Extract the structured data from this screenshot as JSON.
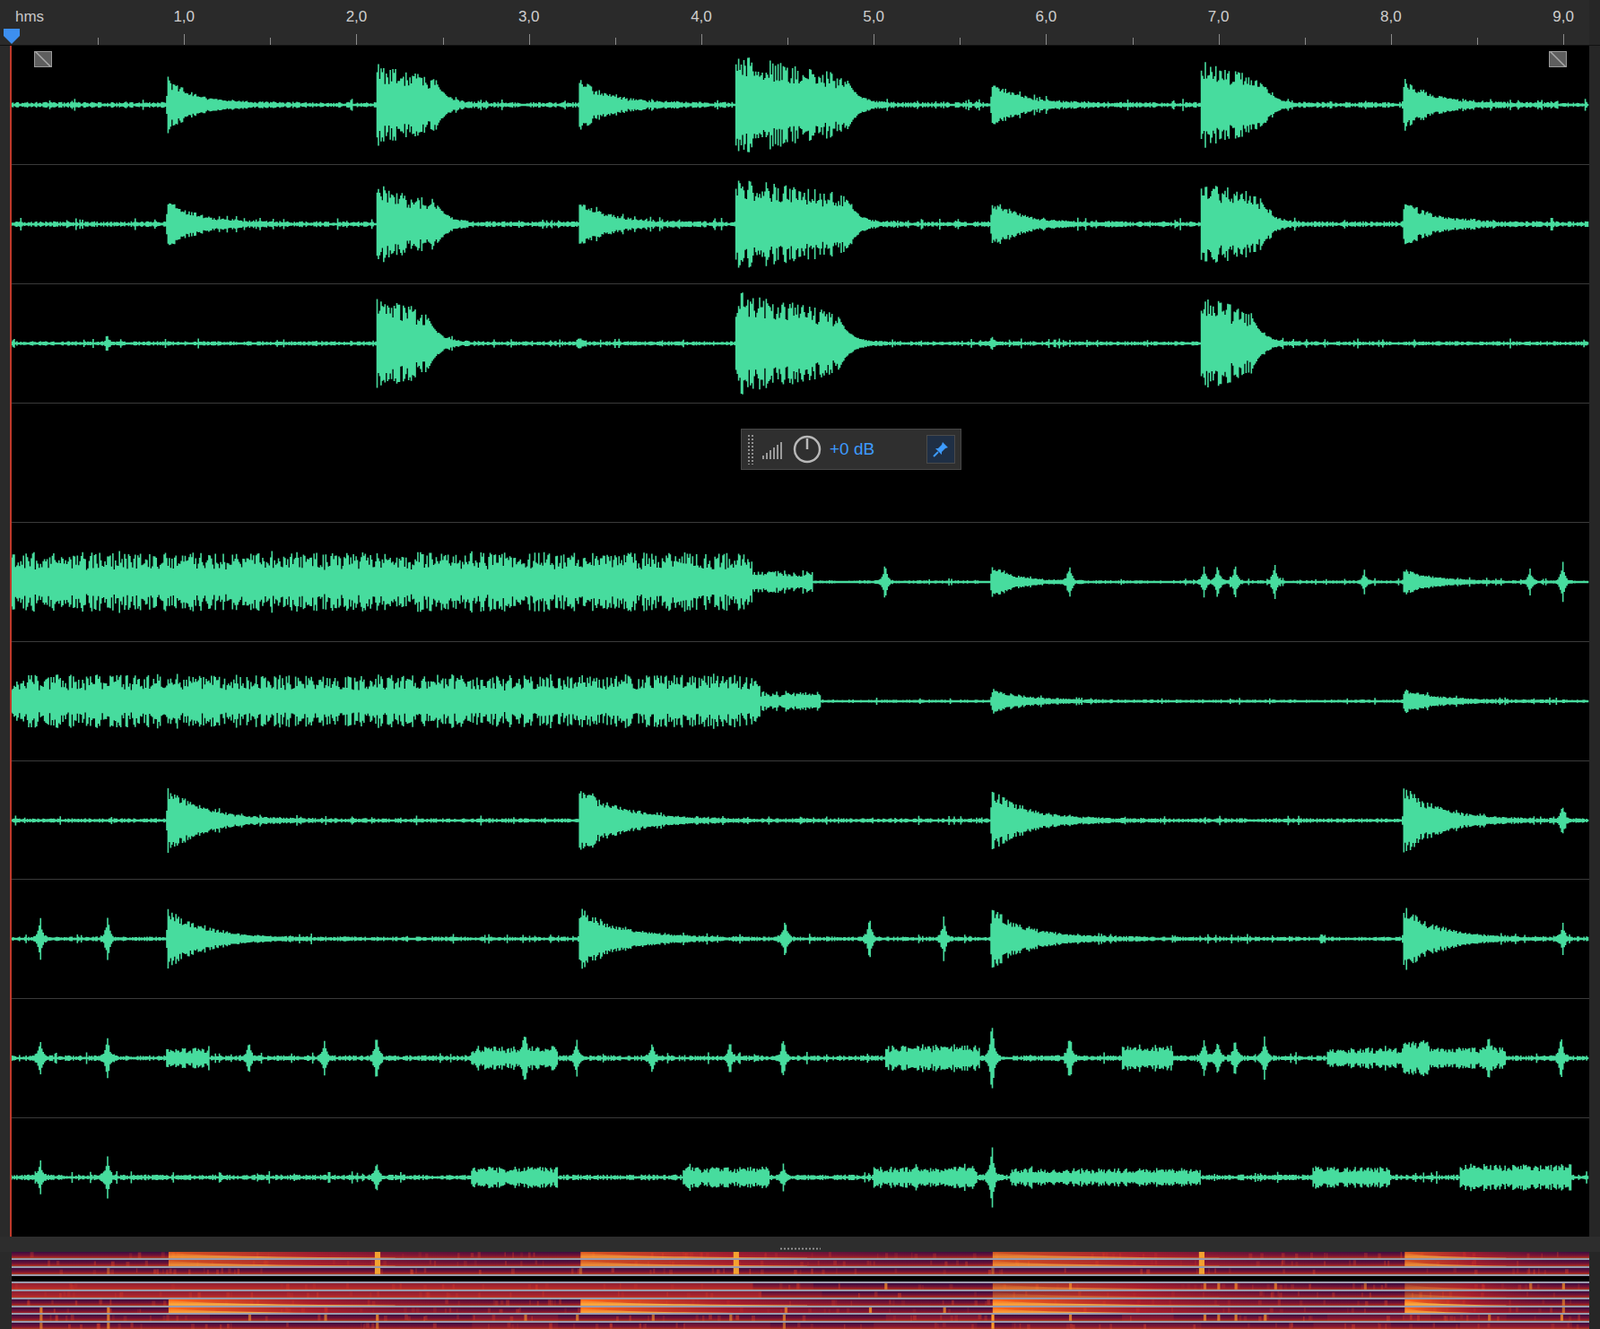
{
  "ruler": {
    "unit": "hms",
    "duration": 9.15,
    "labels": [
      {
        "text": "1,0",
        "t": 1
      },
      {
        "text": "2,0",
        "t": 2
      },
      {
        "text": "3,0",
        "t": 3
      },
      {
        "text": "4,0",
        "t": 4
      },
      {
        "text": "5,0",
        "t": 5
      },
      {
        "text": "6,0",
        "t": 6
      },
      {
        "text": "7,0",
        "t": 7
      },
      {
        "text": "8,0",
        "t": 8
      },
      {
        "text": "9,0",
        "t": 9
      }
    ]
  },
  "playhead": 0,
  "markers": [
    {
      "t": 0.18
    },
    {
      "t": 8.97
    }
  ],
  "gain": {
    "reading": "+0 dB",
    "pinned": true
  },
  "channels": [
    {
      "empty": false,
      "noise": 0.05,
      "events": [
        {
          "kind": "decay",
          "t": 0.91,
          "amp": 0.45,
          "len": 0.5
        },
        {
          "kind": "burst",
          "t": 2.12,
          "amp": 0.7,
          "len": 0.35
        },
        {
          "kind": "decay",
          "t": 3.3,
          "amp": 0.45,
          "len": 0.5
        },
        {
          "kind": "burst",
          "t": 4.2,
          "amp": 0.85,
          "len": 0.65
        },
        {
          "kind": "decay",
          "t": 5.69,
          "amp": 0.4,
          "len": 0.5
        },
        {
          "kind": "burst",
          "t": 6.9,
          "amp": 0.75,
          "len": 0.35
        },
        {
          "kind": "decay",
          "t": 8.08,
          "amp": 0.45,
          "len": 0.5
        }
      ]
    },
    {
      "empty": false,
      "noise": 0.05,
      "events": [
        {
          "kind": "decay",
          "t": 0.91,
          "amp": 0.42,
          "len": 0.5
        },
        {
          "kind": "burst",
          "t": 2.12,
          "amp": 0.65,
          "len": 0.35
        },
        {
          "kind": "decay",
          "t": 3.3,
          "amp": 0.42,
          "len": 0.5
        },
        {
          "kind": "burst",
          "t": 4.2,
          "amp": 0.8,
          "len": 0.65
        },
        {
          "kind": "decay",
          "t": 5.69,
          "amp": 0.42,
          "len": 0.5
        },
        {
          "kind": "burst",
          "t": 6.9,
          "amp": 0.75,
          "len": 0.35
        },
        {
          "kind": "decay",
          "t": 8.08,
          "amp": 0.42,
          "len": 0.5
        }
      ]
    },
    {
      "empty": false,
      "noise": 0.04,
      "events": [
        {
          "kind": "spike",
          "t": 0.56,
          "amp": 0.12,
          "len": 0.02
        },
        {
          "kind": "burst",
          "t": 2.12,
          "amp": 0.85,
          "len": 0.3
        },
        {
          "kind": "spike",
          "t": 3.3,
          "amp": 0.12,
          "len": 0.02
        },
        {
          "kind": "burst",
          "t": 4.2,
          "amp": 0.9,
          "len": 0.6
        },
        {
          "kind": "spike",
          "t": 5.69,
          "amp": 0.12,
          "len": 0.02
        },
        {
          "kind": "burst",
          "t": 6.9,
          "amp": 0.85,
          "len": 0.3
        }
      ]
    },
    {
      "empty": true,
      "noise": 0,
      "events": []
    },
    {
      "empty": false,
      "noise": 0.03,
      "events": [
        {
          "kind": "sustain",
          "t": 0,
          "amp": 0.5,
          "len": 4.3
        },
        {
          "kind": "sustain",
          "t": 4.3,
          "amp": 0.18,
          "len": 0.35
        },
        {
          "kind": "spike",
          "t": 5.07,
          "amp": 0.4,
          "len": 0.02
        },
        {
          "kind": "decay",
          "t": 5.69,
          "amp": 0.3,
          "len": 0.4
        },
        {
          "kind": "spike",
          "t": 6.14,
          "amp": 0.35,
          "len": 0.02
        },
        {
          "kind": "spike",
          "t": 6.92,
          "amp": 0.3,
          "len": 0.02
        },
        {
          "kind": "spike",
          "t": 7.0,
          "amp": 0.35,
          "len": 0.02
        },
        {
          "kind": "spike",
          "t": 7.1,
          "amp": 0.35,
          "len": 0.02
        },
        {
          "kind": "spike",
          "t": 7.33,
          "amp": 0.35,
          "len": 0.02
        },
        {
          "kind": "spike",
          "t": 7.85,
          "amp": 0.2,
          "len": 0.02
        },
        {
          "kind": "decay",
          "t": 8.08,
          "amp": 0.22,
          "len": 0.5
        },
        {
          "kind": "spike",
          "t": 8.81,
          "amp": 0.25,
          "len": 0.02
        },
        {
          "kind": "spike",
          "t": 9.0,
          "amp": 0.4,
          "len": 0.02
        }
      ]
    },
    {
      "empty": false,
      "noise": 0.03,
      "events": [
        {
          "kind": "sustain",
          "t": 0,
          "amp": 0.45,
          "len": 4.35
        },
        {
          "kind": "sustain",
          "t": 4.35,
          "amp": 0.15,
          "len": 0.35
        },
        {
          "kind": "decay",
          "t": 5.69,
          "amp": 0.2,
          "len": 0.6
        },
        {
          "kind": "decay",
          "t": 8.08,
          "amp": 0.2,
          "len": 0.6
        }
      ]
    },
    {
      "empty": false,
      "noise": 0.04,
      "events": [
        {
          "kind": "decay",
          "t": 0.91,
          "amp": 0.6,
          "len": 0.6
        },
        {
          "kind": "decay",
          "t": 3.3,
          "amp": 0.6,
          "len": 0.7
        },
        {
          "kind": "decay",
          "t": 5.69,
          "amp": 0.55,
          "len": 0.6
        },
        {
          "kind": "decay",
          "t": 8.08,
          "amp": 0.6,
          "len": 0.6
        },
        {
          "kind": "spike",
          "t": 9.0,
          "amp": 0.3,
          "len": 0.02
        }
      ]
    },
    {
      "empty": false,
      "noise": 0.04,
      "events": [
        {
          "kind": "spike",
          "t": 0.17,
          "amp": 0.4,
          "len": 0.02
        },
        {
          "kind": "spike",
          "t": 0.56,
          "amp": 0.45,
          "len": 0.02
        },
        {
          "kind": "decay",
          "t": 0.91,
          "amp": 0.55,
          "len": 0.6
        },
        {
          "kind": "decay",
          "t": 3.3,
          "amp": 0.55,
          "len": 0.7
        },
        {
          "kind": "spike",
          "t": 4.49,
          "amp": 0.35,
          "len": 0.02
        },
        {
          "kind": "spike",
          "t": 4.98,
          "amp": 0.45,
          "len": 0.02
        },
        {
          "kind": "spike",
          "t": 5.41,
          "amp": 0.4,
          "len": 0.02
        },
        {
          "kind": "decay",
          "t": 5.69,
          "amp": 0.55,
          "len": 0.6
        },
        {
          "kind": "decay",
          "t": 8.08,
          "amp": 0.55,
          "len": 0.6
        },
        {
          "kind": "spike",
          "t": 9.0,
          "amp": 0.3,
          "len": 0.02
        }
      ]
    },
    {
      "empty": false,
      "noise": 0.05,
      "events": [
        {
          "kind": "spike",
          "t": 0.17,
          "amp": 0.35,
          "len": 0.02
        },
        {
          "kind": "spike",
          "t": 0.56,
          "amp": 0.4,
          "len": 0.02
        },
        {
          "kind": "sustain",
          "t": 0.9,
          "amp": 0.15,
          "len": 0.25
        },
        {
          "kind": "spike",
          "t": 1.38,
          "amp": 0.3,
          "len": 0.02
        },
        {
          "kind": "spike",
          "t": 1.82,
          "amp": 0.3,
          "len": 0.02
        },
        {
          "kind": "spike",
          "t": 2.12,
          "amp": 0.45,
          "len": 0.02
        },
        {
          "kind": "sustain",
          "t": 2.67,
          "amp": 0.18,
          "len": 0.5
        },
        {
          "kind": "spike",
          "t": 2.98,
          "amp": 0.3,
          "len": 0.02
        },
        {
          "kind": "spike",
          "t": 3.28,
          "amp": 0.35,
          "len": 0.02
        },
        {
          "kind": "spike",
          "t": 3.72,
          "amp": 0.3,
          "len": 0.02
        },
        {
          "kind": "spike",
          "t": 4.17,
          "amp": 0.3,
          "len": 0.02
        },
        {
          "kind": "spike",
          "t": 4.48,
          "amp": 0.35,
          "len": 0.02
        },
        {
          "kind": "sustain",
          "t": 5.07,
          "amp": 0.2,
          "len": 0.55
        },
        {
          "kind": "spike",
          "t": 5.69,
          "amp": 0.75,
          "len": 0.02
        },
        {
          "kind": "spike",
          "t": 6.14,
          "amp": 0.45,
          "len": 0.02
        },
        {
          "kind": "sustain",
          "t": 6.44,
          "amp": 0.2,
          "len": 0.3
        },
        {
          "kind": "spike",
          "t": 6.92,
          "amp": 0.4,
          "len": 0.02
        },
        {
          "kind": "spike",
          "t": 7.0,
          "amp": 0.4,
          "len": 0.02
        },
        {
          "kind": "spike",
          "t": 7.1,
          "amp": 0.4,
          "len": 0.02
        },
        {
          "kind": "spike",
          "t": 7.27,
          "amp": 0.4,
          "len": 0.02
        },
        {
          "kind": "sustain",
          "t": 7.63,
          "amp": 0.15,
          "len": 0.6
        },
        {
          "kind": "sustain",
          "t": 8.07,
          "amp": 0.15,
          "len": 0.6
        },
        {
          "kind": "spike",
          "t": 8.57,
          "amp": 0.3,
          "len": 0.02
        },
        {
          "kind": "spike",
          "t": 8.99,
          "amp": 0.45,
          "len": 0.02
        }
      ]
    },
    {
      "empty": false,
      "noise": 0.05,
      "events": [
        {
          "kind": "spike",
          "t": 0.17,
          "amp": 0.3,
          "len": 0.02
        },
        {
          "kind": "spike",
          "t": 0.56,
          "amp": 0.4,
          "len": 0.02
        },
        {
          "kind": "spike",
          "t": 2.12,
          "amp": 0.3,
          "len": 0.02
        },
        {
          "kind": "sustain",
          "t": 2.67,
          "amp": 0.15,
          "len": 0.5
        },
        {
          "kind": "sustain",
          "t": 3.9,
          "amp": 0.15,
          "len": 0.5
        },
        {
          "kind": "spike",
          "t": 4.48,
          "amp": 0.25,
          "len": 0.02
        },
        {
          "kind": "sustain",
          "t": 5.0,
          "amp": 0.15,
          "len": 0.6
        },
        {
          "kind": "spike",
          "t": 5.69,
          "amp": 0.7,
          "len": 0.02
        },
        {
          "kind": "sustain",
          "t": 5.8,
          "amp": 0.12,
          "len": 1.1
        },
        {
          "kind": "sustain",
          "t": 7.55,
          "amp": 0.15,
          "len": 0.45
        },
        {
          "kind": "sustain",
          "t": 8.4,
          "amp": 0.2,
          "len": 0.65
        }
      ]
    }
  ]
}
